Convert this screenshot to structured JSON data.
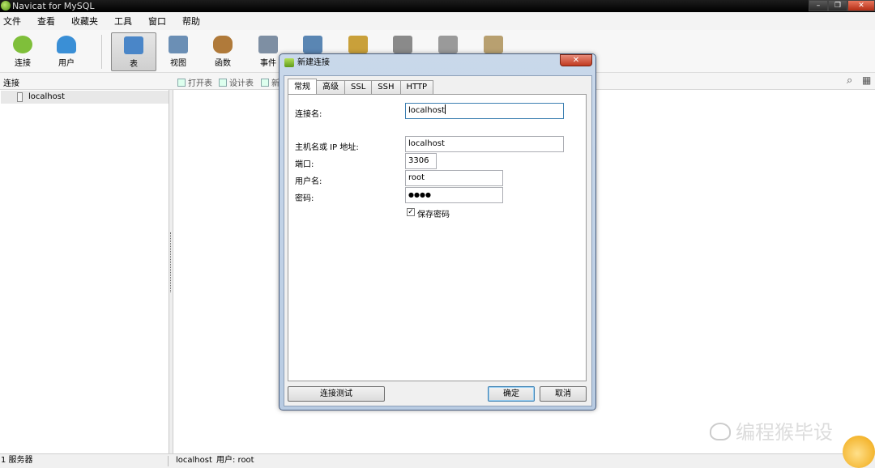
{
  "app": {
    "title": "Navicat for MySQL",
    "window_controls": {
      "minimize": "–",
      "restore": "❐",
      "close": "✕"
    }
  },
  "menu": [
    "文件",
    "查看",
    "收藏夹",
    "工具",
    "窗口",
    "帮助"
  ],
  "toolbar": [
    {
      "label": "连接",
      "icon": "connect-icon",
      "color": "#7fbf3a"
    },
    {
      "label": "用户",
      "icon": "user-icon",
      "color": "#3a8fd6"
    },
    {
      "label": "表",
      "icon": "table-icon",
      "color": "#4a86c8",
      "active": true
    },
    {
      "label": "视图",
      "icon": "view-icon",
      "color": "#6b8fb5"
    },
    {
      "label": "函数",
      "icon": "function-icon",
      "color": "#b07a3a"
    },
    {
      "label": "事件",
      "icon": "event-icon",
      "color": "#7e8fa3"
    },
    {
      "label": "",
      "icon": "query-icon",
      "color": "#5a86b3"
    },
    {
      "label": "",
      "icon": "report-icon",
      "color": "#c9a03a"
    },
    {
      "label": "",
      "icon": "backup-icon",
      "color": "#8a8a8a"
    },
    {
      "label": "",
      "icon": "schedule-icon",
      "color": "#9a9a9a"
    },
    {
      "label": "",
      "icon": "model-icon",
      "color": "#b8a070"
    }
  ],
  "subbar": {
    "label": "连接",
    "actions": [
      "打开表",
      "设计表",
      "新"
    ]
  },
  "tree": {
    "items": [
      "localhost"
    ]
  },
  "status": {
    "left": "1 服务器",
    "conn": "localhost",
    "user": "用户: root"
  },
  "watermark": "编程猴毕设",
  "dialog": {
    "title": "新建连接",
    "close": "✕",
    "tabs": [
      "常规",
      "高级",
      "SSL",
      "SSH",
      "HTTP"
    ],
    "fields": {
      "conn_name_label": "连接名:",
      "conn_name": "localhost",
      "host_label": "主机名或 IP 地址:",
      "host": "localhost",
      "port_label": "端口:",
      "port": "3306",
      "user_label": "用户名:",
      "user": "root",
      "password_label": "密码:",
      "password": "●●●●",
      "save_password_label": "保存密码",
      "save_password": true
    },
    "buttons": {
      "test": "连接测试",
      "ok": "确定",
      "cancel": "取消"
    }
  }
}
